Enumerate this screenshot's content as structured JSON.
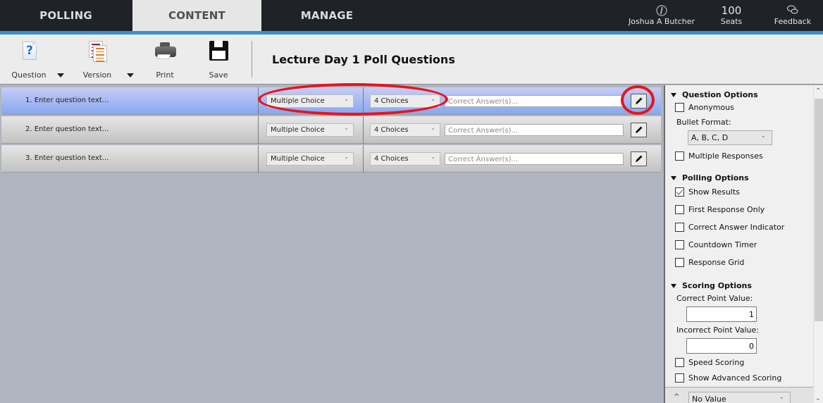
{
  "nav": {
    "tabs": [
      {
        "label": "POLLING",
        "active": false
      },
      {
        "label": "CONTENT",
        "active": true
      },
      {
        "label": "MANAGE",
        "active": false
      }
    ],
    "user": {
      "name": "Joshua A Butcher",
      "icon": "info-circle-icon"
    },
    "seats": {
      "count": "100",
      "label": "Seats"
    },
    "feedback": {
      "label": "Feedback",
      "icon": "chat-bubbles-icon"
    },
    "accent_color": "#3a8fd0"
  },
  "toolbar": {
    "question_label": "Question",
    "version_label": "Version",
    "print_label": "Print",
    "save_label": "Save",
    "title": "Lecture Day 1 Poll Questions"
  },
  "questions": [
    {
      "text": "1. Enter question text...",
      "type": "Multiple Choice",
      "choices": "4 Choices",
      "answer_placeholder": "Correct Answer(s)...",
      "selected": true
    },
    {
      "text": "2. Enter question text...",
      "type": "Multiple Choice",
      "choices": "4 Choices",
      "answer_placeholder": "Correct Answer(s)...",
      "selected": false
    },
    {
      "text": "3. Enter question text...",
      "type": "Multiple Choice",
      "choices": "4 Choices",
      "answer_placeholder": "Correct Answer(s)...",
      "selected": false
    }
  ],
  "annotations": {
    "color": "#e8141c"
  },
  "panel": {
    "question_options": {
      "title": "Question Options",
      "anonymous": {
        "label": "Anonymous",
        "checked": false
      },
      "bullet_format_label": "Bullet Format:",
      "bullet_format_value": "A, B, C, D",
      "multiple_responses": {
        "label": "Multiple Responses",
        "checked": false
      }
    },
    "polling_options": {
      "title": "Polling Options",
      "items": [
        {
          "label": "Show Results",
          "checked": true
        },
        {
          "label": "First Response Only",
          "checked": false
        },
        {
          "label": "Correct Answer Indicator",
          "checked": false
        },
        {
          "label": "Countdown Timer",
          "checked": false
        },
        {
          "label": "Response Grid",
          "checked": false
        }
      ]
    },
    "scoring_options": {
      "title": "Scoring Options",
      "correct_label": "Correct Point Value:",
      "correct_value": "1",
      "incorrect_label": "Incorrect Point Value:",
      "incorrect_value": "0",
      "speed_scoring": {
        "label": "Speed Scoring",
        "checked": false
      },
      "advanced_scoring": {
        "label": "Show Advanced Scoring",
        "checked": false
      }
    },
    "footer": {
      "caret": "^",
      "select_value": "No Value"
    }
  }
}
